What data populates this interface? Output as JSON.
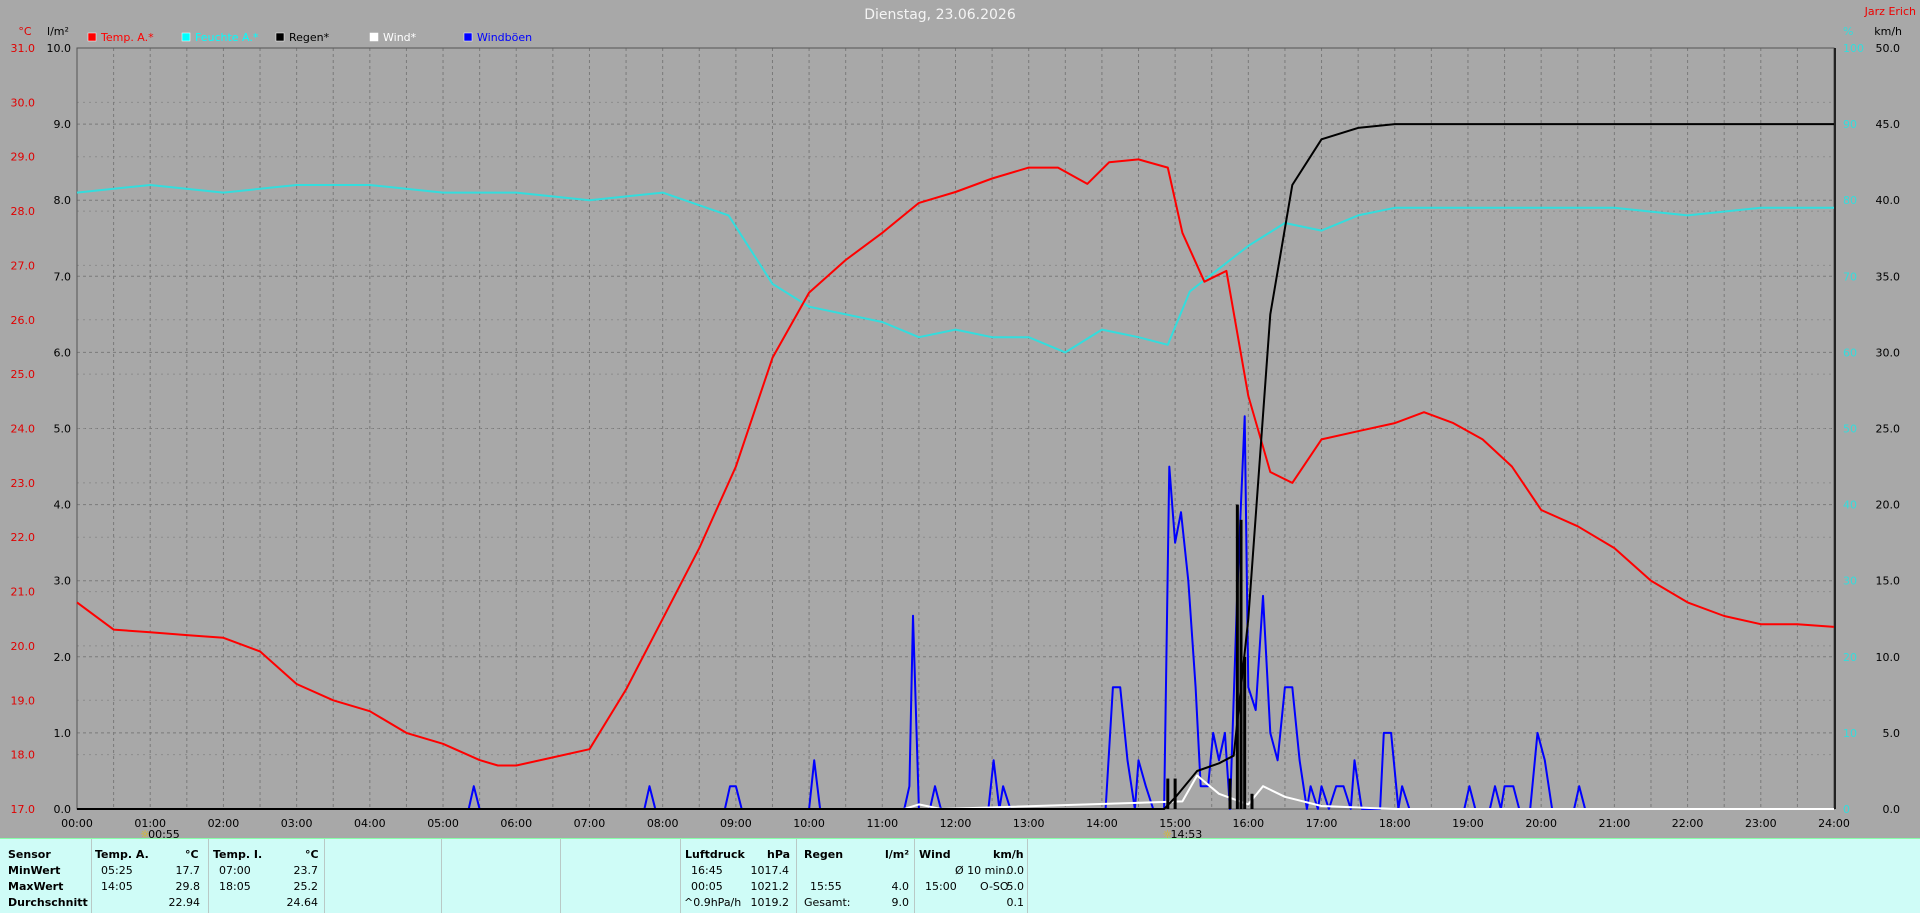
{
  "window": {
    "title": "Dienstag, 23.06.2026",
    "station": "Jarz Erich"
  },
  "axes": {
    "left_unit_temp": "°C",
    "left_unit_rain": "l/m²",
    "right_unit_hum": "%",
    "right_unit_wind": "km/h",
    "temp_ticks": [
      "17.0",
      "18.0",
      "19.0",
      "20.0",
      "21.0",
      "22.0",
      "23.0",
      "24.0",
      "25.0",
      "26.0",
      "27.0",
      "28.0",
      "29.0",
      "30.0",
      "31.0"
    ],
    "rain_ticks": [
      "0.0",
      "1.0",
      "2.0",
      "3.0",
      "4.0",
      "5.0",
      "6.0",
      "7.0",
      "8.0",
      "9.0",
      "10.0"
    ],
    "hum_ticks": [
      "0",
      "10",
      "20",
      "30",
      "40",
      "50",
      "60",
      "70",
      "80",
      "90",
      "100"
    ],
    "wind_ticks": [
      "0.0",
      "5.0",
      "10.0",
      "15.0",
      "20.0",
      "25.0",
      "30.0",
      "35.0",
      "40.0",
      "45.0",
      "50.0"
    ],
    "time_ticks": [
      "00:00",
      "01:00",
      "02:00",
      "03:00",
      "04:00",
      "05:00",
      "06:00",
      "07:00",
      "08:00",
      "09:00",
      "10:00",
      "11:00",
      "12:00",
      "13:00",
      "14:00",
      "15:00",
      "16:00",
      "17:00",
      "18:00",
      "19:00",
      "20:00",
      "21:00",
      "22:00",
      "23:00",
      "24:00"
    ],
    "markers": [
      {
        "time": 0.9167,
        "label": "00:55"
      },
      {
        "time": 14.883,
        "label": "14:53"
      }
    ]
  },
  "legend": [
    {
      "label": "Temp. A.*",
      "color": "#ff0000"
    },
    {
      "label": "Feuchte A.*",
      "color": "#00ffff"
    },
    {
      "label": "Regen*",
      "color": "#000000"
    },
    {
      "label": "Wind*",
      "color": "#ffffff"
    },
    {
      "label": "Windböen",
      "color": "#0000ff"
    }
  ],
  "colors": {
    "temp": "#ff0000",
    "hum": "#33dddd",
    "rain": "#000000",
    "wind": "#ffffff",
    "gust": "#0000ff",
    "plot_bg": "#a8a8a8",
    "stats_bg": "#cffcf7"
  },
  "chart_data": {
    "type": "line",
    "title": "Dienstag, 23.06.2026",
    "xlim": [
      0,
      24
    ],
    "temp_ylim": [
      17,
      31
    ],
    "rain_ylim": [
      0,
      10
    ],
    "hum_ylim": [
      0,
      100
    ],
    "wind_ylim": [
      0,
      50
    ],
    "grid": true,
    "series": [
      {
        "name": "Temp. A.*",
        "axis": "temp",
        "points": [
          [
            0,
            20.8
          ],
          [
            0.5,
            20.3
          ],
          [
            1,
            20.25
          ],
          [
            1.5,
            20.2
          ],
          [
            2,
            20.15
          ],
          [
            2.5,
            19.9
          ],
          [
            3,
            19.3
          ],
          [
            3.5,
            19.0
          ],
          [
            4,
            18.8
          ],
          [
            4.5,
            18.4
          ],
          [
            5,
            18.2
          ],
          [
            5.5,
            17.9
          ],
          [
            5.75,
            17.8
          ],
          [
            6,
            17.8
          ],
          [
            6.5,
            17.95
          ],
          [
            7,
            18.1
          ],
          [
            7.5,
            19.2
          ],
          [
            8,
            20.5
          ],
          [
            8.5,
            21.8
          ],
          [
            9,
            23.3
          ],
          [
            9.5,
            25.3
          ],
          [
            10,
            26.5
          ],
          [
            10.5,
            27.1
          ],
          [
            11,
            27.6
          ],
          [
            11.5,
            28.15
          ],
          [
            12,
            28.35
          ],
          [
            12.5,
            28.6
          ],
          [
            13,
            28.8
          ],
          [
            13.4,
            28.8
          ],
          [
            13.8,
            28.5
          ],
          [
            14.1,
            28.9
          ],
          [
            14.5,
            28.95
          ],
          [
            14.9,
            28.8
          ],
          [
            15.1,
            27.6
          ],
          [
            15.4,
            26.7
          ],
          [
            15.7,
            26.9
          ],
          [
            16.0,
            24.6
          ],
          [
            16.3,
            23.2
          ],
          [
            16.6,
            23.0
          ],
          [
            17,
            23.8
          ],
          [
            17.5,
            23.95
          ],
          [
            18,
            24.1
          ],
          [
            18.4,
            24.3
          ],
          [
            18.8,
            24.1
          ],
          [
            19.2,
            23.8
          ],
          [
            19.6,
            23.3
          ],
          [
            20,
            22.5
          ],
          [
            20.5,
            22.2
          ],
          [
            21,
            21.8
          ],
          [
            21.5,
            21.2
          ],
          [
            22,
            20.8
          ],
          [
            22.5,
            20.55
          ],
          [
            23,
            20.4
          ],
          [
            23.5,
            20.4
          ],
          [
            24,
            20.35
          ]
        ]
      },
      {
        "name": "Feuchte A.*",
        "axis": "hum",
        "points": [
          [
            0,
            81
          ],
          [
            1,
            82
          ],
          [
            2,
            81
          ],
          [
            3,
            82
          ],
          [
            4,
            82
          ],
          [
            5,
            81
          ],
          [
            6,
            81
          ],
          [
            7,
            80
          ],
          [
            8,
            81
          ],
          [
            8.9,
            78
          ],
          [
            9.5,
            69
          ],
          [
            10,
            66
          ],
          [
            11,
            64
          ],
          [
            11.5,
            62
          ],
          [
            12,
            63
          ],
          [
            12.5,
            62
          ],
          [
            13,
            62
          ],
          [
            13.5,
            60
          ],
          [
            14,
            63
          ],
          [
            14.5,
            62
          ],
          [
            14.9,
            61
          ],
          [
            15.2,
            68
          ],
          [
            15.6,
            71
          ],
          [
            16,
            74
          ],
          [
            16.5,
            77
          ],
          [
            17,
            76
          ],
          [
            17.5,
            78
          ],
          [
            18,
            79
          ],
          [
            18.5,
            79
          ],
          [
            19,
            79
          ],
          [
            20,
            79
          ],
          [
            21,
            79
          ],
          [
            22,
            78
          ],
          [
            23,
            79
          ],
          [
            24,
            79
          ]
        ]
      },
      {
        "name": "Regen*",
        "axis": "rain",
        "points": [
          [
            0,
            0
          ],
          [
            14.85,
            0
          ],
          [
            15,
            0.15
          ],
          [
            15.3,
            0.5
          ],
          [
            15.6,
            0.6
          ],
          [
            15.8,
            0.7
          ],
          [
            16.0,
            2.5
          ],
          [
            16.3,
            6.5
          ],
          [
            16.6,
            8.2
          ],
          [
            17,
            8.8
          ],
          [
            17.5,
            8.95
          ],
          [
            18,
            9.0
          ],
          [
            24,
            9.0
          ]
        ]
      },
      {
        "name": "Regen* bars",
        "axis": "rain",
        "bars": [
          [
            14.9,
            0.4
          ],
          [
            15.0,
            0.4
          ],
          [
            15.75,
            0.4
          ],
          [
            15.85,
            4.0
          ],
          [
            15.9,
            3.8
          ],
          [
            15.95,
            2.0
          ],
          [
            16.05,
            0.2
          ]
        ]
      },
      {
        "name": "Wind*",
        "axis": "wind",
        "points": [
          [
            11.3,
            0
          ],
          [
            11.5,
            0.3
          ],
          [
            11.8,
            0
          ],
          [
            15.1,
            0.5
          ],
          [
            15.3,
            2.2
          ],
          [
            15.6,
            1.0
          ],
          [
            16,
            0.3
          ],
          [
            16.2,
            1.5
          ],
          [
            16.5,
            0.8
          ],
          [
            17,
            0.2
          ],
          [
            18,
            0
          ],
          [
            24,
            0
          ]
        ]
      },
      {
        "name": "Windböen",
        "axis": "wind",
        "points": [
          [
            0,
            0
          ],
          [
            5.35,
            0
          ],
          [
            5.42,
            1.5
          ],
          [
            5.5,
            0
          ],
          [
            7.75,
            0
          ],
          [
            7.82,
            1.5
          ],
          [
            7.9,
            0
          ],
          [
            8.85,
            0
          ],
          [
            8.92,
            1.5
          ],
          [
            9.0,
            1.5
          ],
          [
            9.08,
            0
          ],
          [
            10.0,
            0
          ],
          [
            10.07,
            3.2
          ],
          [
            10.15,
            0
          ],
          [
            11.3,
            0
          ],
          [
            11.37,
            1.5
          ],
          [
            11.42,
            12.7
          ],
          [
            11.5,
            0
          ],
          [
            11.65,
            0
          ],
          [
            11.72,
            1.5
          ],
          [
            11.8,
            0
          ],
          [
            12.45,
            0
          ],
          [
            12.52,
            3.2
          ],
          [
            12.6,
            0
          ],
          [
            12.65,
            1.5
          ],
          [
            12.75,
            0
          ],
          [
            14.05,
            0
          ],
          [
            14.15,
            8.0
          ],
          [
            14.25,
            8.0
          ],
          [
            14.35,
            3.2
          ],
          [
            14.45,
            0
          ],
          [
            14.5,
            3.2
          ],
          [
            14.6,
            1.5
          ],
          [
            14.7,
            0
          ],
          [
            14.85,
            0
          ],
          [
            14.92,
            22.5
          ],
          [
            15.0,
            17.5
          ],
          [
            15.08,
            19.5
          ],
          [
            15.18,
            15.0
          ],
          [
            15.28,
            8.0
          ],
          [
            15.35,
            1.5
          ],
          [
            15.45,
            1.5
          ],
          [
            15.52,
            5.0
          ],
          [
            15.6,
            3.2
          ],
          [
            15.68,
            5.0
          ],
          [
            15.75,
            0
          ],
          [
            15.85,
            14.5
          ],
          [
            15.95,
            25.8
          ],
          [
            16.0,
            8.0
          ],
          [
            16.1,
            6.5
          ],
          [
            16.2,
            14.0
          ],
          [
            16.3,
            5.0
          ],
          [
            16.4,
            3.2
          ],
          [
            16.5,
            8.0
          ],
          [
            16.6,
            8.0
          ],
          [
            16.7,
            3.2
          ],
          [
            16.8,
            0
          ],
          [
            16.85,
            1.5
          ],
          [
            16.95,
            0
          ],
          [
            17.0,
            1.5
          ],
          [
            17.1,
            0
          ],
          [
            17.2,
            1.5
          ],
          [
            17.3,
            1.5
          ],
          [
            17.4,
            0
          ],
          [
            17.45,
            3.2
          ],
          [
            17.55,
            0
          ],
          [
            17.8,
            0
          ],
          [
            17.85,
            5.0
          ],
          [
            17.95,
            5.0
          ],
          [
            18.05,
            0
          ],
          [
            18.1,
            1.5
          ],
          [
            18.2,
            0
          ],
          [
            18.95,
            0
          ],
          [
            19.02,
            1.5
          ],
          [
            19.1,
            0
          ],
          [
            19.3,
            0
          ],
          [
            19.37,
            1.5
          ],
          [
            19.45,
            0
          ],
          [
            19.5,
            1.5
          ],
          [
            19.62,
            1.5
          ],
          [
            19.7,
            0
          ],
          [
            19.85,
            0
          ],
          [
            19.95,
            5.0
          ],
          [
            20.05,
            3.2
          ],
          [
            20.15,
            0
          ],
          [
            20.45,
            0
          ],
          [
            20.52,
            1.5
          ],
          [
            20.6,
            0
          ],
          [
            24,
            0
          ]
        ]
      }
    ]
  },
  "stats": {
    "sensor": {
      "title": "Sensor",
      "rows": [
        "MinWert",
        "MaxWert",
        "Durchschnitt"
      ]
    },
    "tempA": {
      "title": "Temp. A.",
      "unit": "°C",
      "min_time": "05:25",
      "min": "17.7",
      "max_time": "14:05",
      "max": "29.8",
      "avg": "22.94"
    },
    "tempI": {
      "title": "Temp. I.",
      "unit": "°C",
      "min_time": "07:00",
      "min": "23.7",
      "max_time": "18:05",
      "max": "25.2",
      "avg": "24.64"
    },
    "pressure": {
      "title": "Luftdruck",
      "unit": "hPa",
      "min_time": "16:45",
      "min": "1017.4",
      "max_time": "00:05",
      "max": "1021.2",
      "trend": "^0.9hPa/h",
      "avg": "1019.2"
    },
    "rain": {
      "title": "Regen",
      "unit": "l/m²",
      "max_time": "15:55",
      "max": "4.0",
      "total_label": "Gesamt:",
      "total": "9.0"
    },
    "wind": {
      "title": "Wind",
      "unit": "km/h",
      "row1_label": "Ø 10 min.",
      "row1_value": "0.0",
      "row2_time": "15:00",
      "row2_dir": "O-SO",
      "row2_value": "5.0",
      "row3_value": "0.1"
    }
  }
}
